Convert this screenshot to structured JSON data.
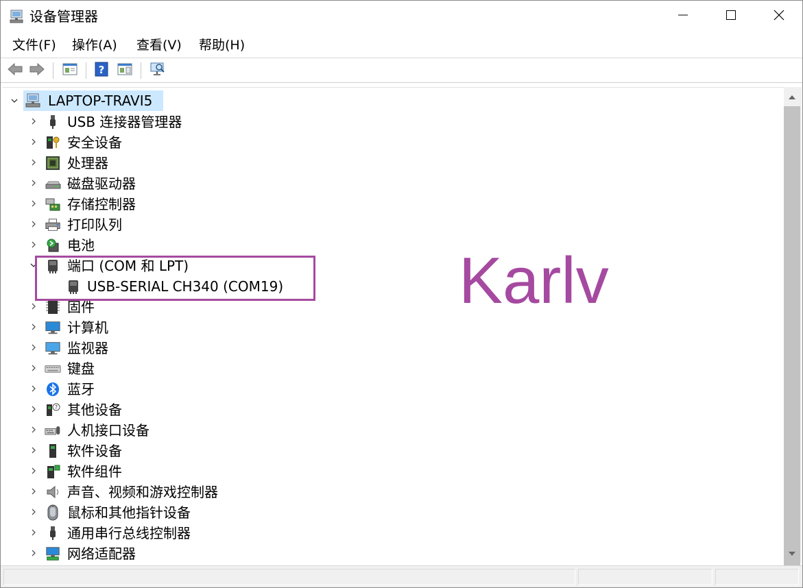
{
  "window": {
    "title": "设备管理器",
    "controls": {
      "minimize": "minimize-icon",
      "maximize": "maximize-icon",
      "close": "close-icon"
    }
  },
  "menu": {
    "items": [
      {
        "label": "文件(F)"
      },
      {
        "label": "操作(A)"
      },
      {
        "label": "查看(V)"
      },
      {
        "label": "帮助(H)"
      }
    ]
  },
  "toolbar": {
    "buttons": [
      {
        "icon": "back-arrow-icon"
      },
      {
        "icon": "forward-arrow-icon"
      },
      {
        "icon": "properties-icon"
      },
      {
        "icon": "help-icon"
      },
      {
        "icon": "action-pane-icon"
      },
      {
        "icon": "scan-hardware-icon"
      }
    ]
  },
  "tree": {
    "root": {
      "label": "LAPTOP-TRAVI5",
      "icon": "computer-root-icon",
      "expanded": true,
      "selected": true
    },
    "categories": [
      {
        "label": "USB 连接器管理器",
        "icon": "usb-connector-icon",
        "expanded": false
      },
      {
        "label": "安全设备",
        "icon": "security-device-icon",
        "expanded": false
      },
      {
        "label": "处理器",
        "icon": "processor-icon",
        "expanded": false
      },
      {
        "label": "磁盘驱动器",
        "icon": "disk-drive-icon",
        "expanded": false
      },
      {
        "label": "存储控制器",
        "icon": "storage-controller-icon",
        "expanded": false
      },
      {
        "label": "打印队列",
        "icon": "printer-icon",
        "expanded": false
      },
      {
        "label": "电池",
        "icon": "battery-icon",
        "expanded": false
      },
      {
        "label": "端口 (COM 和 LPT)",
        "icon": "port-icon",
        "expanded": true,
        "children": [
          {
            "label": "USB-SERIAL CH340 (COM19)",
            "icon": "port-icon"
          }
        ]
      },
      {
        "label": "固件",
        "icon": "firmware-icon",
        "expanded": false
      },
      {
        "label": "计算机",
        "icon": "computer-icon",
        "expanded": false
      },
      {
        "label": "监视器",
        "icon": "monitor-icon",
        "expanded": false
      },
      {
        "label": "键盘",
        "icon": "keyboard-icon",
        "expanded": false
      },
      {
        "label": "蓝牙",
        "icon": "bluetooth-icon",
        "expanded": false
      },
      {
        "label": "其他设备",
        "icon": "other-devices-icon",
        "expanded": false
      },
      {
        "label": "人机接口设备",
        "icon": "hid-icon",
        "expanded": false
      },
      {
        "label": "软件设备",
        "icon": "software-device-icon",
        "expanded": false
      },
      {
        "label": "软件组件",
        "icon": "software-component-icon",
        "expanded": false
      },
      {
        "label": "声音、视频和游戏控制器",
        "icon": "sound-icon",
        "expanded": false
      },
      {
        "label": "鼠标和其他指针设备",
        "icon": "mouse-icon",
        "expanded": false
      },
      {
        "label": "通用串行总线控制器",
        "icon": "usb-controller-icon",
        "expanded": false
      },
      {
        "label": "网络适配器",
        "icon": "network-adapter-icon",
        "expanded": false
      }
    ]
  },
  "annotation": {
    "watermark": "Karlv",
    "color": "#a54aa0"
  },
  "colors": {
    "selection": "#cce8ff",
    "accent": "#a54aa0"
  }
}
